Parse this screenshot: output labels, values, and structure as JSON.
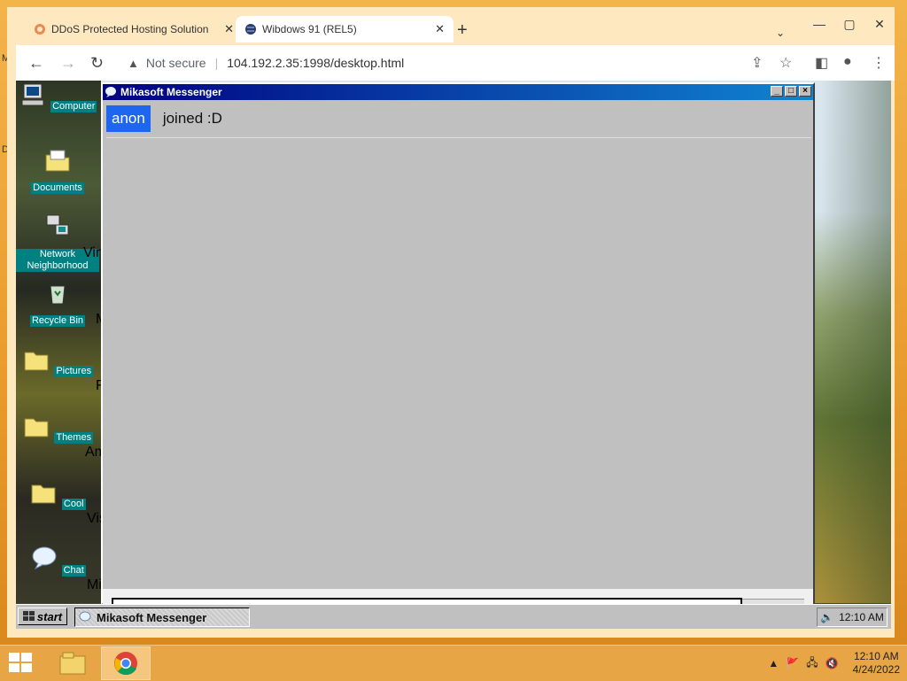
{
  "os": {
    "edge_letters": [
      "M",
      "D"
    ],
    "taskbar": {
      "clock_time": "12:10 AM",
      "clock_date": "4/24/2022"
    }
  },
  "browser": {
    "tabs": [
      {
        "title": "DDoS Protected Hosting Solution",
        "active": false
      },
      {
        "title": "Wibdows 91 (REL5)",
        "active": true
      }
    ],
    "security_label": "Not secure",
    "url": "104.192.2.35:1998/desktop.html"
  },
  "wibdows": {
    "desktop_icons": [
      {
        "label": "Computer",
        "icon": "computer-icon"
      },
      {
        "label": "Documents",
        "icon": "folder-documents-icon"
      },
      {
        "label": "Network Neighborhood",
        "icon": "network-icon"
      },
      {
        "label": "Recycle Bin",
        "icon": "recycle-bin-icon"
      },
      {
        "label": "Pictures",
        "icon": "folder-icon"
      },
      {
        "label": "Themes",
        "icon": "folder-icon"
      },
      {
        "label": "Cool",
        "icon": "folder-icon"
      },
      {
        "label": "Chat",
        "icon": "chat-icon"
      }
    ],
    "cut_labels": [
      "Virt",
      "M",
      "F",
      "Am",
      "Vis",
      "Mi"
    ],
    "messenger": {
      "title": "Mikasoft Messenger",
      "messages": [
        {
          "user": "anon",
          "text": "joined :D"
        }
      ]
    },
    "taskbar": {
      "start_label": "start",
      "task_label": "Mikasoft Messenger",
      "clock": "12:10 AM"
    }
  },
  "colors": {
    "os_accent": "#e9a43a",
    "win_titlebar": "#000080",
    "chat_user_badge": "#1e66f0",
    "desktop_label_bg": "#008080"
  }
}
